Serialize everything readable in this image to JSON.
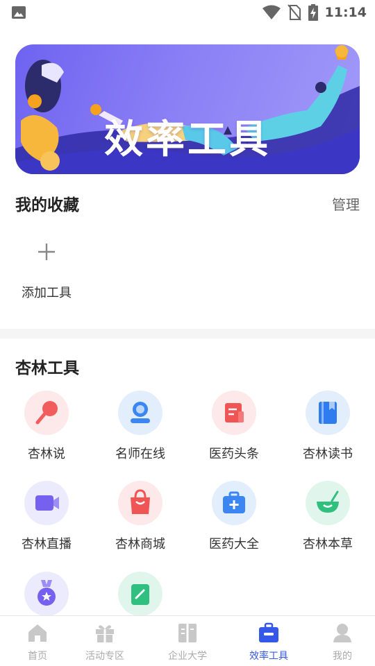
{
  "status_bar": {
    "time": "11:14",
    "icons": [
      "image-icon",
      "wifi-icon",
      "no-sim-icon",
      "battery-charging-icon"
    ]
  },
  "banner": {
    "title": "效率工具"
  },
  "favorites": {
    "title": "我的收藏",
    "manage_label": "管理",
    "add_tool_label": "添加工具"
  },
  "tools_section": {
    "title": "杏林工具",
    "items": [
      {
        "label": "杏林说",
        "icon": "microphone-icon",
        "bg": "#fde9e9",
        "color": "#f25c5c"
      },
      {
        "label": "名师在线",
        "icon": "teacher-icon",
        "bg": "#e3eefc",
        "color": "#3b86f2"
      },
      {
        "label": "医药头条",
        "icon": "news-icon",
        "bg": "#fde9e9",
        "color": "#f05555"
      },
      {
        "label": "杏林读书",
        "icon": "book-icon",
        "bg": "#e3eefc",
        "color": "#2f7bf0"
      },
      {
        "label": "杏林直播",
        "icon": "video-camera-icon",
        "bg": "#ecebfd",
        "color": "#7560f0"
      },
      {
        "label": "杏林商城",
        "icon": "shopping-bag-icon",
        "bg": "#fde9e9",
        "color": "#f05555"
      },
      {
        "label": "医药大全",
        "icon": "medical-kit-icon",
        "bg": "#e3eefc",
        "color": "#3b86f2"
      },
      {
        "label": "杏林本草",
        "icon": "herb-bowl-icon",
        "bg": "#e0f6ec",
        "color": "#2fbf7f"
      },
      {
        "label": "",
        "icon": "medal-icon",
        "bg": "#ecebfd",
        "color": "#7560f0"
      },
      {
        "label": "",
        "icon": "note-edit-icon",
        "bg": "#e0f6ec",
        "color": "#2fbf7f"
      }
    ]
  },
  "tab_bar": {
    "tabs": [
      {
        "label": "首页",
        "icon": "home-icon",
        "active": false
      },
      {
        "label": "活动专区",
        "icon": "gift-icon",
        "active": false
      },
      {
        "label": "企业大学",
        "icon": "university-book-icon",
        "active": false
      },
      {
        "label": "效率工具",
        "icon": "toolbox-icon",
        "active": true
      },
      {
        "label": "我的",
        "icon": "user-icon",
        "active": false
      }
    ],
    "active_color": "#3658e8",
    "inactive_color": "#c8c8c8"
  }
}
